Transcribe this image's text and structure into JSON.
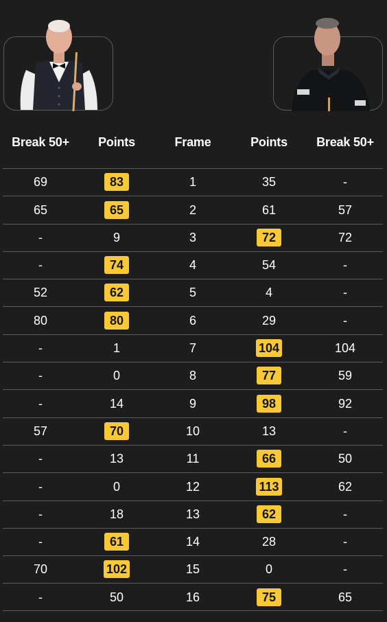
{
  "players": {
    "left": {
      "alt": "player-left-photo"
    },
    "right": {
      "alt": "player-right-photo"
    }
  },
  "colors": {
    "background": "#1d1d1d",
    "divider": "#5b5b5b",
    "winner_highlight": "#f7c937",
    "text": "#ffffff"
  },
  "headers": {
    "left_break": "Break 50+",
    "left_points": "Points",
    "frame": "Frame",
    "right_points": "Points",
    "right_break": "Break 50+"
  },
  "frames": [
    {
      "left_break": "69",
      "left_points": "83",
      "frame": "1",
      "right_points": "35",
      "right_break": "-",
      "winner": "left"
    },
    {
      "left_break": "65",
      "left_points": "65",
      "frame": "2",
      "right_points": "61",
      "right_break": "57",
      "winner": "left"
    },
    {
      "left_break": "-",
      "left_points": "9",
      "frame": "3",
      "right_points": "72",
      "right_break": "72",
      "winner": "right"
    },
    {
      "left_break": "-",
      "left_points": "74",
      "frame": "4",
      "right_points": "54",
      "right_break": "-",
      "winner": "left"
    },
    {
      "left_break": "52",
      "left_points": "62",
      "frame": "5",
      "right_points": "4",
      "right_break": "-",
      "winner": "left"
    },
    {
      "left_break": "80",
      "left_points": "80",
      "frame": "6",
      "right_points": "29",
      "right_break": "-",
      "winner": "left"
    },
    {
      "left_break": "-",
      "left_points": "1",
      "frame": "7",
      "right_points": "104",
      "right_break": "104",
      "winner": "right"
    },
    {
      "left_break": "-",
      "left_points": "0",
      "frame": "8",
      "right_points": "77",
      "right_break": "59",
      "winner": "right"
    },
    {
      "left_break": "-",
      "left_points": "14",
      "frame": "9",
      "right_points": "98",
      "right_break": "92",
      "winner": "right"
    },
    {
      "left_break": "57",
      "left_points": "70",
      "frame": "10",
      "right_points": "13",
      "right_break": "-",
      "winner": "left"
    },
    {
      "left_break": "-",
      "left_points": "13",
      "frame": "11",
      "right_points": "66",
      "right_break": "50",
      "winner": "right"
    },
    {
      "left_break": "-",
      "left_points": "0",
      "frame": "12",
      "right_points": "113",
      "right_break": "62",
      "winner": "right"
    },
    {
      "left_break": "-",
      "left_points": "18",
      "frame": "13",
      "right_points": "62",
      "right_break": "-",
      "winner": "right"
    },
    {
      "left_break": "-",
      "left_points": "61",
      "frame": "14",
      "right_points": "28",
      "right_break": "-",
      "winner": "left"
    },
    {
      "left_break": "70",
      "left_points": "102",
      "frame": "15",
      "right_points": "0",
      "right_break": "-",
      "winner": "left"
    },
    {
      "left_break": "-",
      "left_points": "50",
      "frame": "16",
      "right_points": "75",
      "right_break": "65",
      "winner": "right"
    }
  ]
}
